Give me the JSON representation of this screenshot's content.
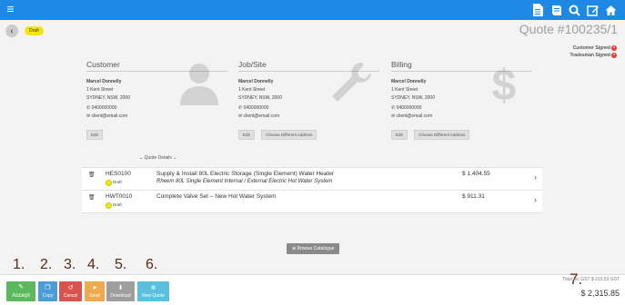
{
  "header": {
    "icons": [
      "menu-icon",
      "document-icon",
      "book-icon",
      "search-icon",
      "edit-icon",
      "home-icon"
    ],
    "accent_color": "#1e88e5"
  },
  "quote": {
    "status": "Draft",
    "title": "Quote #100235/1",
    "customer_signed": "Customer Signed",
    "tradesman_signed": "Tradesman Signed"
  },
  "customer": {
    "heading": "Customer",
    "name": "Marcel Donnelly",
    "street": "1 Kent Street",
    "city": "SYDNEY, NSW, 2000",
    "phone": "0400000000",
    "email": "client@email.com",
    "edit_label": "Edit"
  },
  "jobsite": {
    "heading": "Job/Site",
    "name": "Marcel Donnelly",
    "street": "1 Kent Street",
    "city": "SYDNEY, NSW, 2000",
    "phone": "0400000000",
    "email": "client@email.com",
    "edit_label": "Edit",
    "choose_label": "Choose Different Address"
  },
  "billing": {
    "heading": "Billing",
    "name": "Marcel Donnelly",
    "street": "1 Kent Street",
    "city": "SYDNEY, NSW, 2000",
    "phone": "0400000000",
    "email": "client@email.com",
    "edit_label": "Edit",
    "choose_label": "Choose Different Address"
  },
  "quote_details_label": "Quote Details",
  "items": [
    {
      "code": "HES0100",
      "status": "Draft",
      "description": "Supply & Install 80L Electric Storage (Single Element) Water Heater",
      "subdescription": "Rheem 80L Single Element Internal / External Electric Hot Water System",
      "price": "$ 1,404.55"
    },
    {
      "code": "HWT0010",
      "status": "Draft",
      "description": "Complete Valve Set – New Hot Water System",
      "subdescription": "",
      "price": "$ 911.31"
    }
  ],
  "browse_label": "Browse Catalogue",
  "actions": {
    "accept": "Accept",
    "copy": "Copy",
    "cancel": "Cancel",
    "send": "Send",
    "download": "Download",
    "new_quote": "New Quote"
  },
  "action_colors": {
    "accept": "#5cb85c",
    "copy": "#4a9dd6",
    "cancel": "#d9534f",
    "send": "#f0a94b",
    "download": "#9e9e9e",
    "new_quote": "#5bc0de"
  },
  "callouts": [
    "1.",
    "2.",
    "3.",
    "4.",
    "5.",
    "6.",
    "7."
  ],
  "totals": {
    "subtotal_label": "Total Inc GST",
    "subtotal_value": "$ 210.53 GST",
    "total": "$ 2,315.85"
  }
}
